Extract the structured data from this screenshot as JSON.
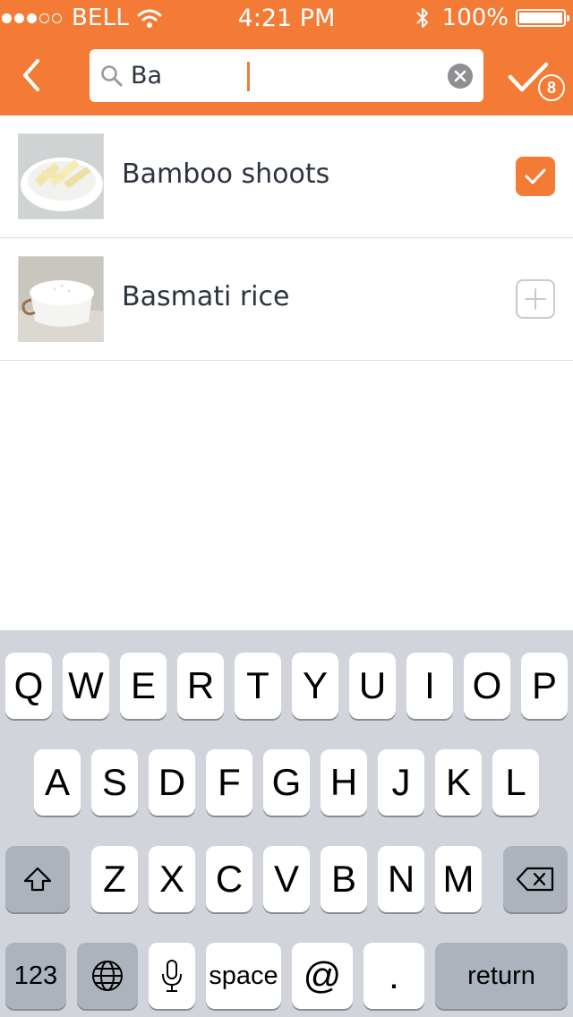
{
  "status_bar": {
    "carrier": "BELL",
    "time": "4:21 PM",
    "battery": "100%",
    "signal_bars_filled": 3,
    "signal_bars_total": 5
  },
  "search": {
    "query": "Ba",
    "back_icon": "chevron-left-icon",
    "search_icon": "magnifier-icon",
    "clear_icon": "clear-x-icon",
    "done_icon": "checkmark-icon",
    "selected_count": "8"
  },
  "results": [
    {
      "name": "Bamboo shoots",
      "selected": true,
      "control_icon": "checkbox-checked-icon"
    },
    {
      "name": "Basmati rice",
      "selected": false,
      "control_icon": "add-plus-icon"
    }
  ],
  "keyboard": {
    "row1": [
      "Q",
      "W",
      "E",
      "R",
      "T",
      "Y",
      "U",
      "I",
      "O",
      "P"
    ],
    "row2": [
      "A",
      "S",
      "D",
      "F",
      "G",
      "H",
      "J",
      "K",
      "L"
    ],
    "row3": [
      "Z",
      "X",
      "C",
      "V",
      "B",
      "N",
      "M"
    ],
    "shift_icon": "shift-arrow-icon",
    "delete_icon": "backspace-icon",
    "numbers_label": "123",
    "globe_icon": "globe-icon",
    "mic_icon": "microphone-icon",
    "space_label": "space",
    "at_label": "@",
    "dot_label": ".",
    "return_label": "return"
  },
  "colors": {
    "accent": "#f47b36",
    "text": "#2c3440",
    "keyboard_bg": "#d1d5db",
    "special_key": "#adb3bc"
  }
}
